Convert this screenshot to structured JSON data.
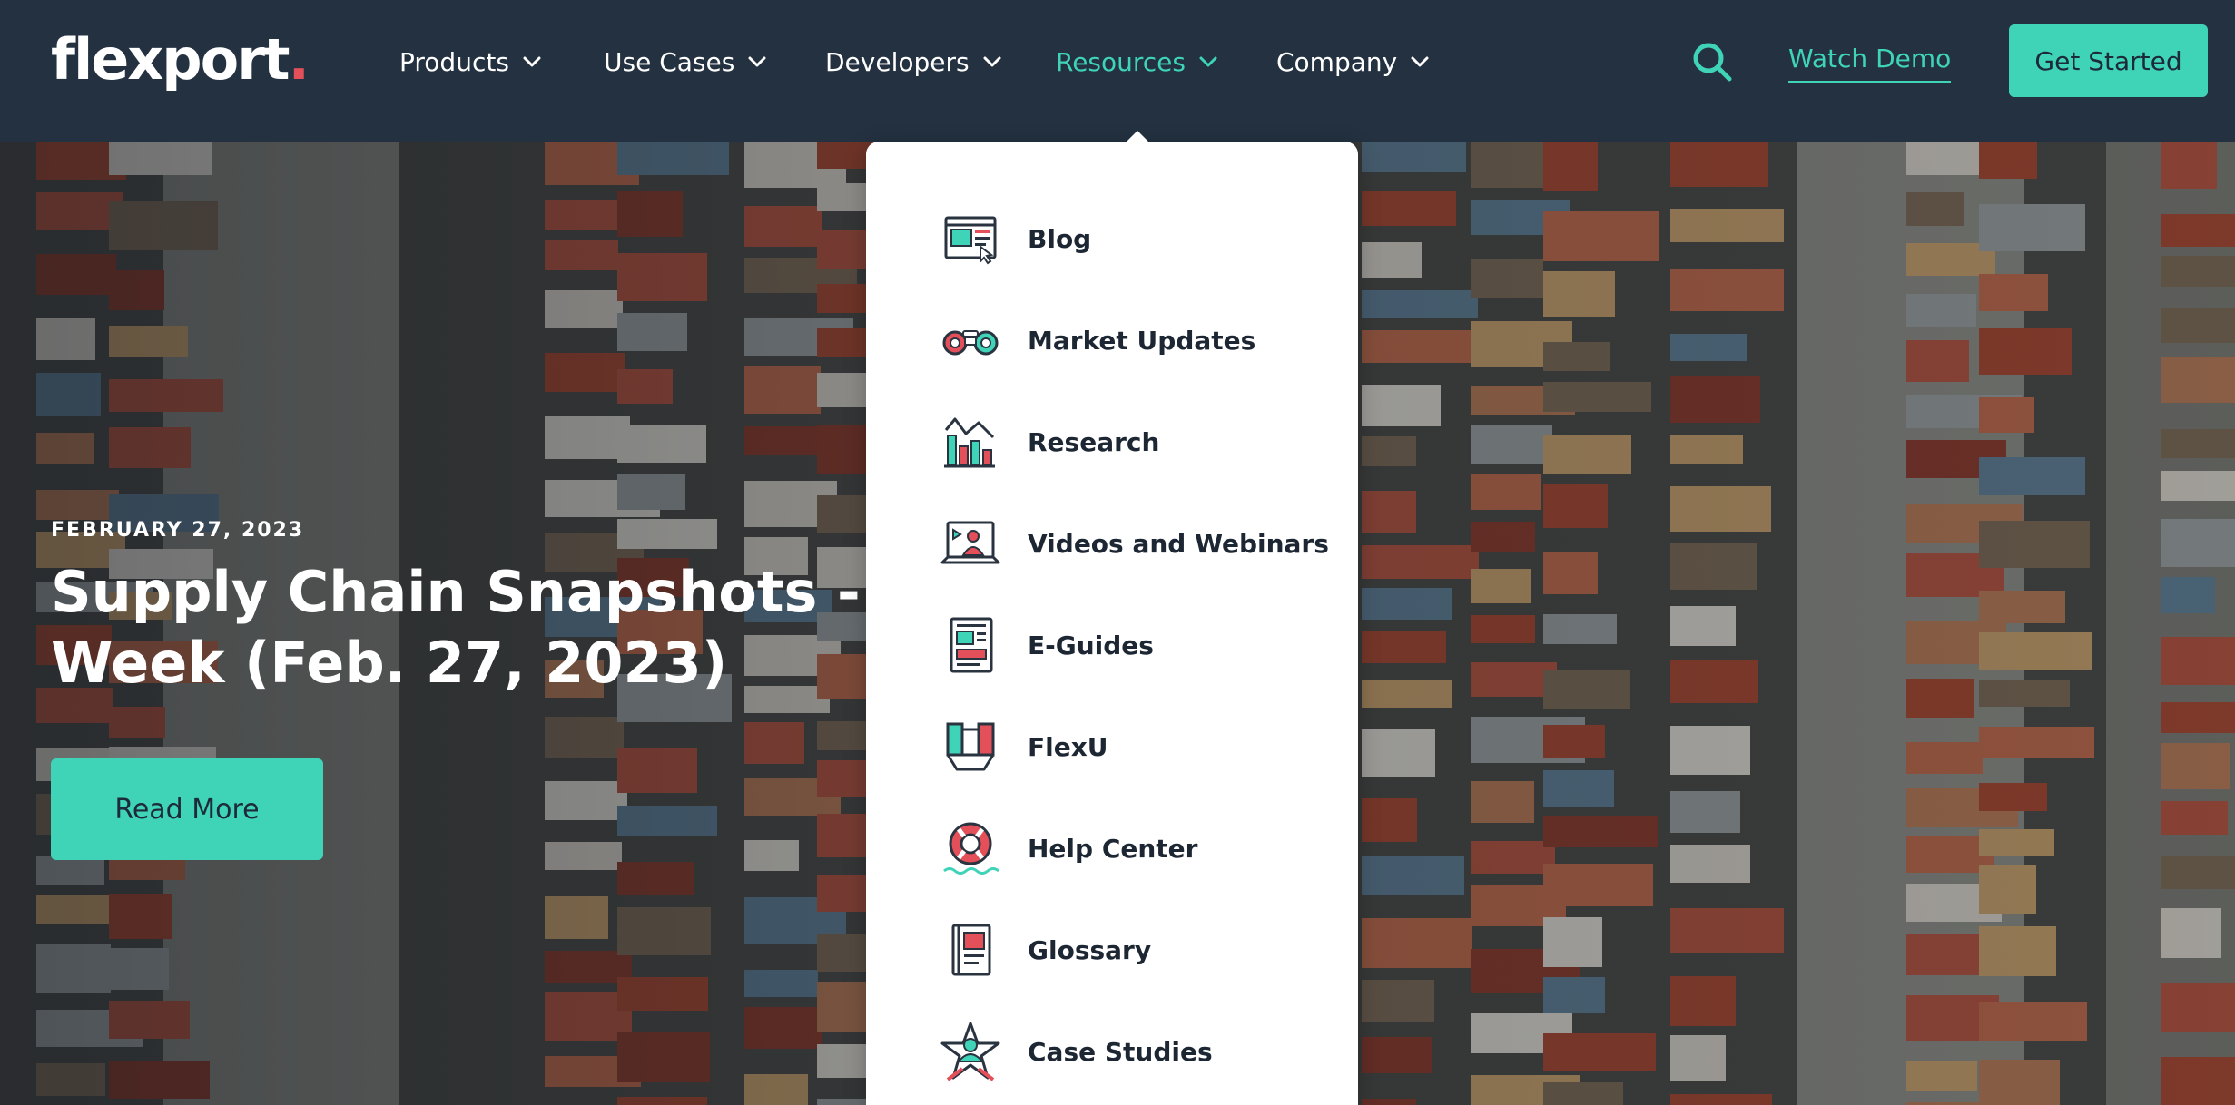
{
  "brand": {
    "logo_text": "flexport",
    "logo_dot": "."
  },
  "nav": {
    "items": [
      {
        "label": "Products"
      },
      {
        "label": "Use Cases"
      },
      {
        "label": "Developers"
      },
      {
        "label": "Resources"
      },
      {
        "label": "Company"
      }
    ],
    "watch_demo": "Watch Demo",
    "get_started": "Get Started"
  },
  "hero": {
    "date": "FEBRUARY 27, 2023",
    "title_line1": "Supply Chain Snapshots - N",
    "title_line2": "Week (Feb. 27, 2023)",
    "cta": "Read More"
  },
  "resources_menu": {
    "items": [
      {
        "label": "Blog",
        "icon": "blog-icon"
      },
      {
        "label": "Market Updates",
        "icon": "binoculars-icon"
      },
      {
        "label": "Research",
        "icon": "bar-chart-icon"
      },
      {
        "label": "Videos and Webinars",
        "icon": "video-presenter-icon"
      },
      {
        "label": "E-Guides",
        "icon": "document-icon"
      },
      {
        "label": "FlexU",
        "icon": "flexu-icon"
      },
      {
        "label": "Help Center",
        "icon": "lifebuoy-icon"
      },
      {
        "label": "Glossary",
        "icon": "book-icon"
      },
      {
        "label": "Case Studies",
        "icon": "star-person-icon"
      }
    ]
  },
  "colors": {
    "navbar_bg": "#233140",
    "accent": "#3fd3b8",
    "logo_dot": "#e4505a",
    "text_dark": "#1d2633"
  }
}
